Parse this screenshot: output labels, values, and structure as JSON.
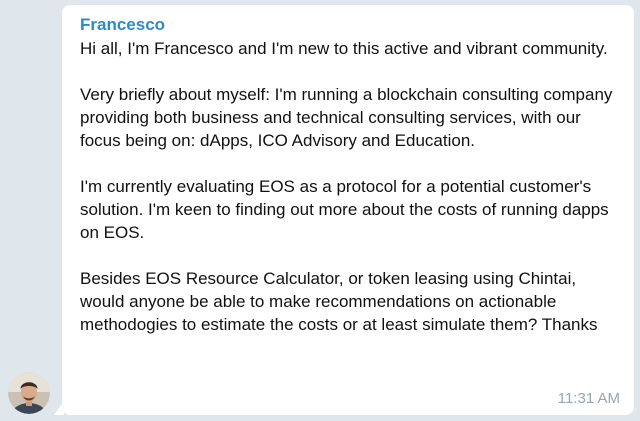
{
  "message": {
    "sender": "Francesco",
    "paragraphs": [
      "Hi all, I'm Francesco and I'm new to this active and vibrant community.",
      "Very briefly about myself: I'm running a blockchain consulting company providing both business and technical consulting services, with our focus being on: dApps, ICO Advisory and Education.",
      "I'm currently evaluating EOS as a protocol for a potential customer's solution. I'm keen to finding out more about the costs of running dapps on EOS.",
      "Besides EOS Resource Calculator, or token leasing using Chintai, would anyone be able to make recommendations on actionable methodogies to estimate the costs or at least simulate them? Thanks"
    ],
    "timestamp": "11:31 AM",
    "avatar_icon": "user-avatar"
  },
  "colors": {
    "background": "#dfe6ec",
    "bubble": "#ffffff",
    "sender": "#2a8cc4",
    "timestamp": "#9aa4ad",
    "text": "#111111"
  }
}
